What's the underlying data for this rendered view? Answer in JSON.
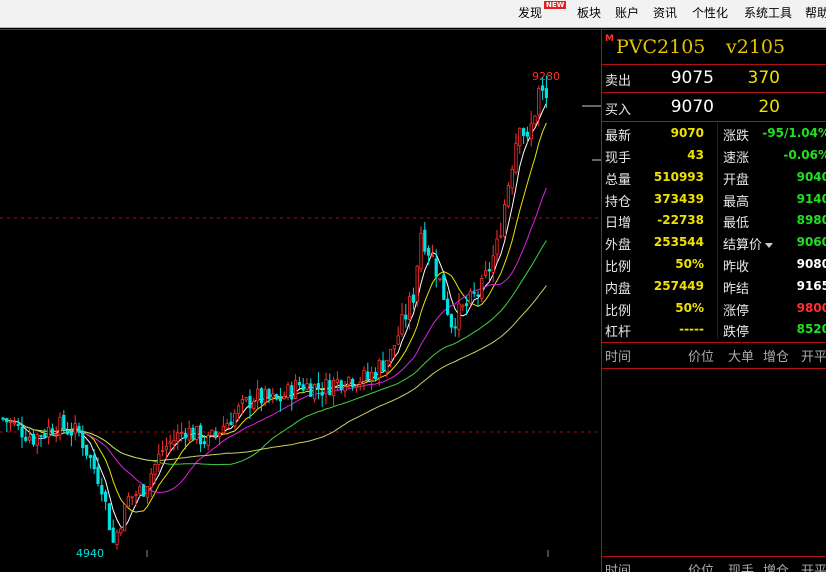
{
  "menu": {
    "items": [
      "发现",
      "板块",
      "账户",
      "资讯",
      "个性化",
      "系统工具",
      "帮助"
    ],
    "new_badge": "NEW"
  },
  "chart": {
    "high_label": "9280",
    "low_label": "4940"
  },
  "quote": {
    "badge": "M",
    "symbol": "PVC2105",
    "code": "v2105",
    "sell_label": "卖出",
    "sell_price": "9075",
    "sell_volume": "370",
    "buy_label": "买入",
    "buy_price": "9070",
    "buy_volume": "20",
    "stats_left": [
      {
        "label": "最新",
        "value": "9070"
      },
      {
        "label": "现手",
        "value": "43"
      },
      {
        "label": "总量",
        "value": "510993"
      },
      {
        "label": "持仓",
        "value": "373439"
      },
      {
        "label": "日增",
        "value": "-22738"
      },
      {
        "label": "外盘",
        "value": "253544"
      },
      {
        "label": "比例",
        "value": "50%"
      },
      {
        "label": "内盘",
        "value": "257449"
      },
      {
        "label": "比例",
        "value": "50%"
      },
      {
        "label": "杠杆",
        "value": "-----"
      }
    ],
    "stats_right": [
      {
        "label": "涨跌",
        "value": "-95/1.04%"
      },
      {
        "label": "速涨",
        "value": "-0.06%"
      },
      {
        "label": "开盘",
        "value": "9040"
      },
      {
        "label": "最高",
        "value": "9140"
      },
      {
        "label": "最低",
        "value": "8980"
      },
      {
        "label": "结算价",
        "value": "9060"
      },
      {
        "label": "昨收",
        "value": "9080"
      },
      {
        "label": "昨结",
        "value": "9165"
      },
      {
        "label": "涨停",
        "value": "9800"
      },
      {
        "label": "跌停",
        "value": "8520"
      }
    ],
    "trades_header": [
      "时间",
      "价位",
      "大单",
      "增仓",
      "开平"
    ],
    "ticks_header": [
      "时间",
      "价位",
      "现手",
      "增仓",
      "开平"
    ]
  },
  "colors": {
    "up": "#ff3030",
    "down": "#00e0e0",
    "ma_white": "#ffffff",
    "ma_yellow": "#e6e600",
    "ma_magenta": "#e020e0",
    "ma_green": "#40d040",
    "ma_olive": "#c8d060",
    "value_yellow": "#f0e000",
    "value_green": "#20e020",
    "value_red": "#ff3030"
  }
}
